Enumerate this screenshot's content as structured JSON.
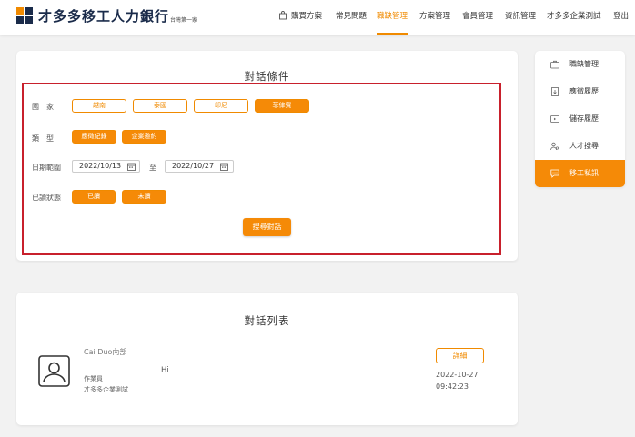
{
  "header": {
    "logo_text": "才多多移工人力銀行",
    "logo_sub": "台灣第一家",
    "nav": {
      "buy_plan": "購買方案",
      "faq": "常見問題",
      "recruit": "職缺管理",
      "plan": "方案管理",
      "member": "會員管理",
      "info": "資訊管理",
      "company": "才多多企業測試",
      "logout": "登出"
    },
    "accent_color": "#f08a00"
  },
  "search": {
    "title": "對話條件",
    "country_label": "國　家",
    "countries": [
      "越南",
      "泰國",
      "印尼",
      "菲律賓"
    ],
    "country_selected": "菲律賓",
    "type_label": "類　型",
    "types": [
      "應徵紀錄",
      "企業邀約"
    ],
    "date_label": "日期範圍",
    "date_from": "2022/10/13",
    "to_label": "至",
    "date_to": "2022/10/27",
    "read_label": "已讀狀態",
    "read_options": [
      "已讀",
      "未讀"
    ],
    "search_button": "搜尋對話"
  },
  "list": {
    "title": "對話列表",
    "item": {
      "sender": "Cai Duo內部",
      "role": "作業員",
      "company": "才多多企業測試",
      "message": "Hi",
      "detail_button": "詳細",
      "date": "2022-10-27",
      "time": "09:42:23"
    }
  },
  "sidebar": {
    "items": [
      {
        "label": "職缺管理",
        "icon": "briefcase-icon"
      },
      {
        "label": "應徵履歷",
        "icon": "resume-download-icon"
      },
      {
        "label": "儲存履歷",
        "icon": "saved-resume-icon"
      },
      {
        "label": "人才搜尋",
        "icon": "people-search-icon"
      },
      {
        "label": "移工私訊",
        "icon": "chat-icon"
      }
    ],
    "active_index": 4
  }
}
